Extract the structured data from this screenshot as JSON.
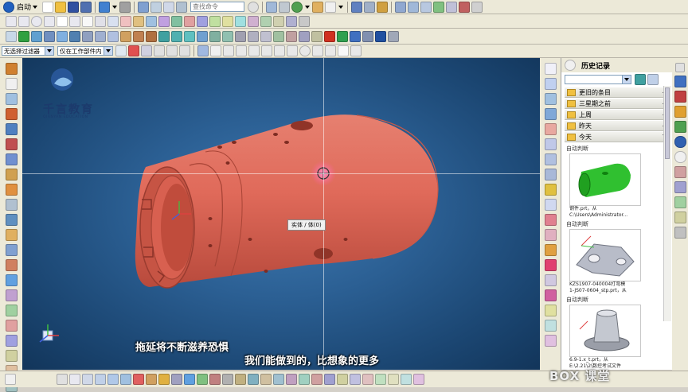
{
  "menu": {
    "start_label": "启动",
    "search_placeholder": "查找命令"
  },
  "selection_bar": {
    "filter_value": "无选择过滤器",
    "scope_value": "仅在工作部件内"
  },
  "history": {
    "title": "历史记录",
    "groups": [
      "更旧的条目",
      "三星期之前",
      "上周",
      "昨天",
      "今天"
    ],
    "entries": [
      {
        "label": "自动判断",
        "caption_lines": [
          "钢件.prt，从",
          "C:\\Users\\Administrator..."
        ]
      },
      {
        "label": "自动判断",
        "caption_lines": [
          "KZS1907-040004打弯模",
          "1-JS07-0604_stp.prt，从"
        ]
      },
      {
        "label": "自动判断",
        "caption_lines": [
          "6.9-1.x_t.prt，从",
          "E:\\2.21\\2\\数控考试文件"
        ]
      }
    ]
  },
  "viewport": {
    "tooltip": "实体 / 体(0)",
    "subtitle_1": "拖延将不断滋养恐惧",
    "subtitle_2": "我们能做到的，比想象的更多",
    "logo_text": "千言教育",
    "logo_sub": "QIANYAN EDUCATION"
  },
  "watermark": "BOX 课堂"
}
